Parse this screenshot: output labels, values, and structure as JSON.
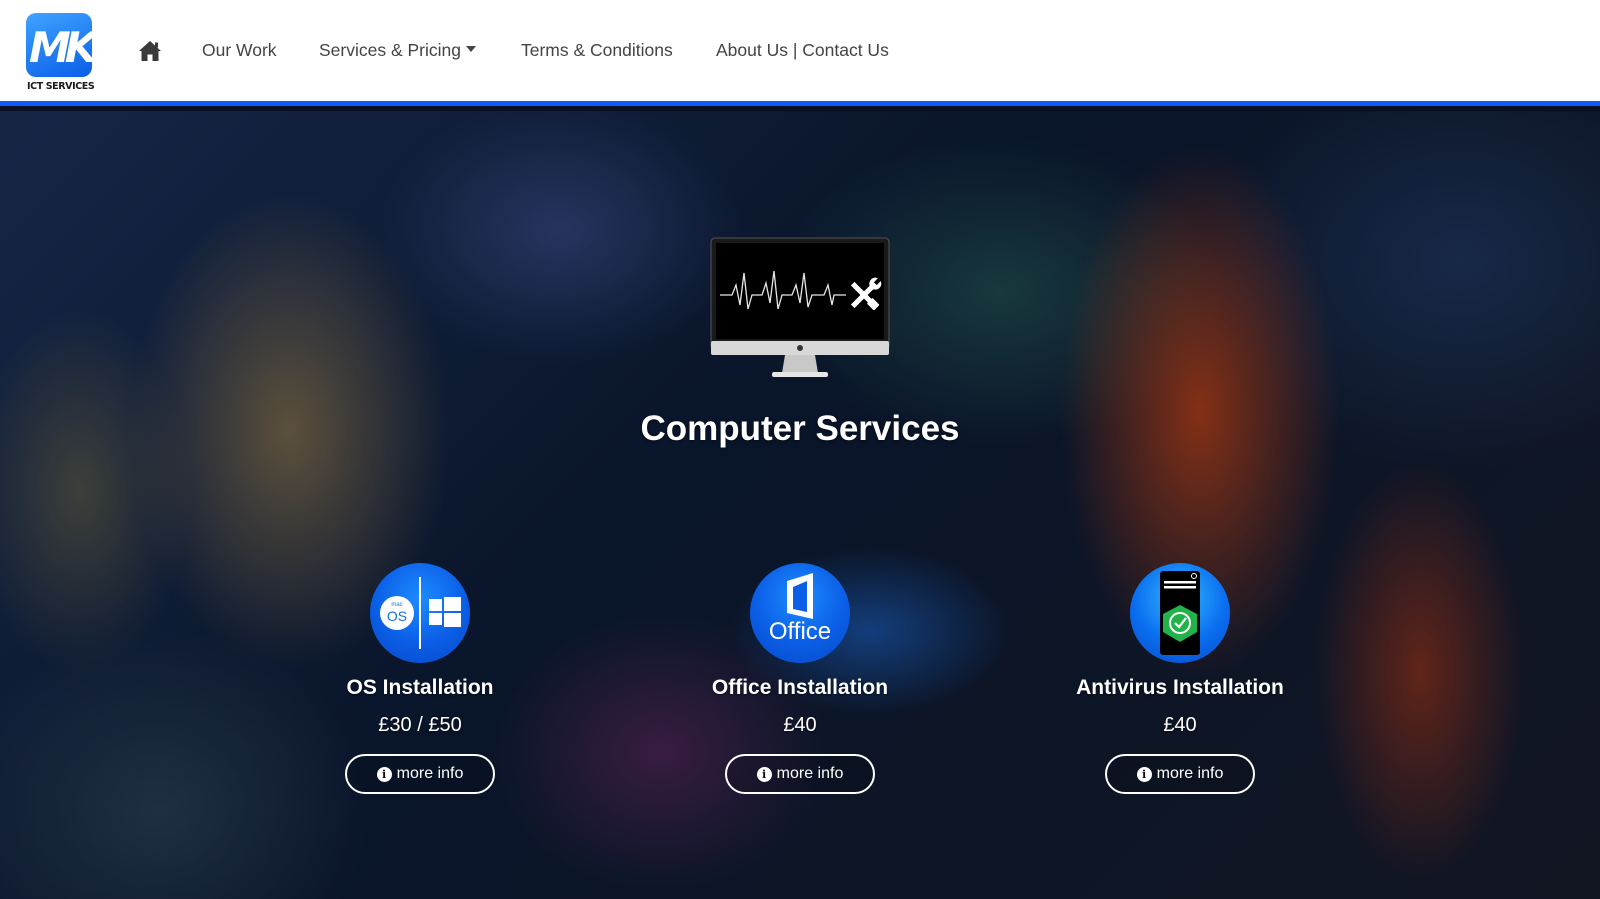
{
  "brand": {
    "logo_letters": "MK",
    "logo_sub": "ICT SERVICES"
  },
  "nav": {
    "home_icon": "home-icon",
    "items": [
      {
        "label": "Our Work"
      },
      {
        "label": "Services & Pricing",
        "has_dropdown": true
      },
      {
        "label": "Terms & Conditions"
      },
      {
        "label": "About Us | Contact Us"
      }
    ]
  },
  "hero": {
    "icon": "monitor-repair-icon",
    "title": "Computer Services"
  },
  "services": [
    {
      "title": "OS Installation",
      "price": "£30 / £50",
      "button": "more info",
      "icon": "macos-windows-icon",
      "macos_label": "mac",
      "os_label": "OS"
    },
    {
      "title": "Office Installation",
      "price": "£40",
      "button": "more info",
      "icon": "office-icon",
      "office_label": "Office"
    },
    {
      "title": "Antivirus Installation",
      "price": "£40",
      "button": "more info",
      "icon": "antivirus-shield-icon"
    }
  ],
  "colors": {
    "accent_blue": "#0a5cff",
    "nav_text": "#444444"
  }
}
